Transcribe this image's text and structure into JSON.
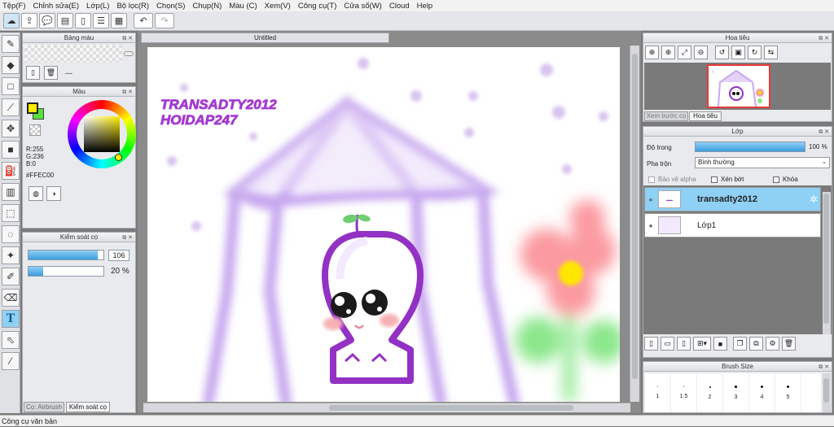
{
  "menu": [
    "Tệp(F)",
    "Chỉnh sửa(E)",
    "Lớp(L)",
    "Bộ lọc(R)",
    "Chọn(S)",
    "Chụp(N)",
    "Màu (C)",
    "Xem(V)",
    "Công cụ(T)",
    "Cửa sổ(W)",
    "Cloud",
    "Help"
  ],
  "document": {
    "tab_title": "Untitled"
  },
  "panels": {
    "swatch": {
      "title": "Bảng màu",
      "dash": "---"
    },
    "color": {
      "title": "Màu",
      "r": "R:255",
      "g": "G:236",
      "b": "B:0",
      "hex": "#FFEC00",
      "fg_color": "#FFEC00",
      "bg_color": "#54E33A"
    },
    "brush_control": {
      "title": "Kiểm soát cọ",
      "size_value": "106",
      "size_fraction": 0.92,
      "opacity_value": "20 %",
      "opacity_fraction": 0.2
    },
    "left_tabs": {
      "tab1": "Cọ: Airbrush",
      "tab2": "Kiểm soát cọ"
    },
    "navigator": {
      "title": "Hoa tiêu",
      "tab_preview": "Xem trước cọ",
      "tab_nav": "Hoa tiêu"
    },
    "layers": {
      "title": "Lớp",
      "opacity_label": "Độ trong",
      "opacity_value": "100 %",
      "opacity_fraction": 1.0,
      "blend_label": "Pha trộn",
      "blend_value": "Bình thường",
      "protect_alpha": "Bảo vệ alpha",
      "clipping": "Xén bớt",
      "lock": "Khóa",
      "items": [
        {
          "name": "transadty2012",
          "selected": true
        },
        {
          "name": "Lớp1",
          "selected": false
        }
      ]
    },
    "brush_size": {
      "title": "Brush Size",
      "sizes": [
        "1",
        "1.5",
        "2",
        "3",
        "4",
        "5"
      ]
    }
  },
  "canvas": {
    "text_line1": "TRANSADTY2012",
    "text_line2": "HOIDAP247"
  },
  "status": {
    "text": "Công cụ văn bản"
  }
}
